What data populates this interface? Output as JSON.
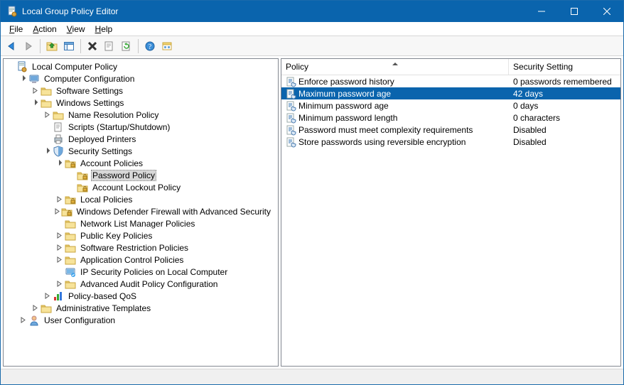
{
  "window": {
    "title": "Local Group Policy Editor"
  },
  "menu": {
    "file": "File",
    "action": "Action",
    "view": "View",
    "help": "Help"
  },
  "tree": {
    "root": "Local Computer Policy",
    "compConfig": "Computer Configuration",
    "softwareSettings": "Software Settings",
    "windowsSettings": "Windows Settings",
    "nameRes": "Name Resolution Policy",
    "scripts": "Scripts (Startup/Shutdown)",
    "deployedPrinters": "Deployed Printers",
    "securitySettings": "Security Settings",
    "accountPolicies": "Account Policies",
    "passwordPolicy": "Password Policy",
    "accountLockout": "Account Lockout Policy",
    "localPolicies": "Local Policies",
    "defenderFW": "Windows Defender Firewall with Advanced Security",
    "netListMgr": "Network List Manager Policies",
    "pubKey": "Public Key Policies",
    "softwareRestrict": "Software Restriction Policies",
    "appControl": "Application Control Policies",
    "ipSec": "IP Security Policies on Local Computer",
    "advAudit": "Advanced Audit Policy Configuration",
    "policyQos": "Policy-based QoS",
    "adminTemplates": "Administrative Templates",
    "userConfig": "User Configuration"
  },
  "list": {
    "columns": {
      "policy": "Policy",
      "setting": "Security Setting"
    },
    "rows": [
      {
        "policy": "Enforce password history",
        "setting": "0 passwords remembered",
        "selected": false
      },
      {
        "policy": "Maximum password age",
        "setting": "42 days",
        "selected": true
      },
      {
        "policy": "Minimum password age",
        "setting": "0 days",
        "selected": false
      },
      {
        "policy": "Minimum password length",
        "setting": "0 characters",
        "selected": false
      },
      {
        "policy": "Password must meet complexity requirements",
        "setting": "Disabled",
        "selected": false
      },
      {
        "policy": "Store passwords using reversible encryption",
        "setting": "Disabled",
        "selected": false
      }
    ]
  }
}
